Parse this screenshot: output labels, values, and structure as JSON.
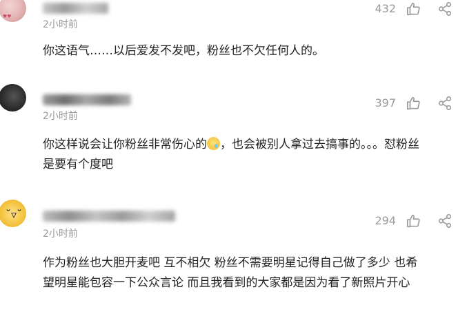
{
  "comments": [
    {
      "time": "2小时前",
      "likes": "432",
      "text": "你这语气……以后爱发不发吧，粉丝也不欠任何人的。"
    },
    {
      "time": "2小时前",
      "likes": "397",
      "text_before_emoji": "你这样说会让你粉丝非常伤心的",
      "text_after_emoji": "，也会被别人拿过去搞事的。。。怼粉丝是要有个度吧",
      "emoji_icon": "sad-sweat-face-icon"
    },
    {
      "time": "2小时前",
      "likes": "294",
      "text": "作为粉丝也大胆开麦吧 互不相欠 粉丝不需要明星记得自己做了多少 也希望明星能包容一下公众言论 而且我看到的大家都是因为看了新照片开心"
    }
  ],
  "colors": {
    "meta_gray": "#9a9a9a",
    "text_dark": "#222222"
  }
}
